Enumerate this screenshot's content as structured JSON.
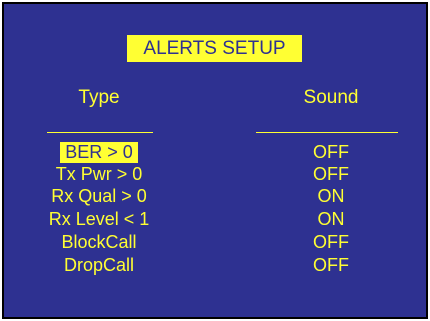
{
  "title": "ALERTS SETUP",
  "headers": {
    "type": "Type",
    "sound": "Sound"
  },
  "rows": [
    {
      "type": "BER > 0",
      "sound": "OFF",
      "selected": true
    },
    {
      "type": "Tx Pwr > 0",
      "sound": "OFF",
      "selected": false
    },
    {
      "type": "Rx Qual > 0",
      "sound": "ON",
      "selected": false
    },
    {
      "type": "Rx Level < 1",
      "sound": "ON",
      "selected": false
    },
    {
      "type": "BlockCall",
      "sound": "OFF",
      "selected": false
    },
    {
      "type": "DropCall",
      "sound": "OFF",
      "selected": false
    }
  ],
  "colors": {
    "background": "#2e3191",
    "text": "#ffff33",
    "highlight": "#ffff33"
  }
}
